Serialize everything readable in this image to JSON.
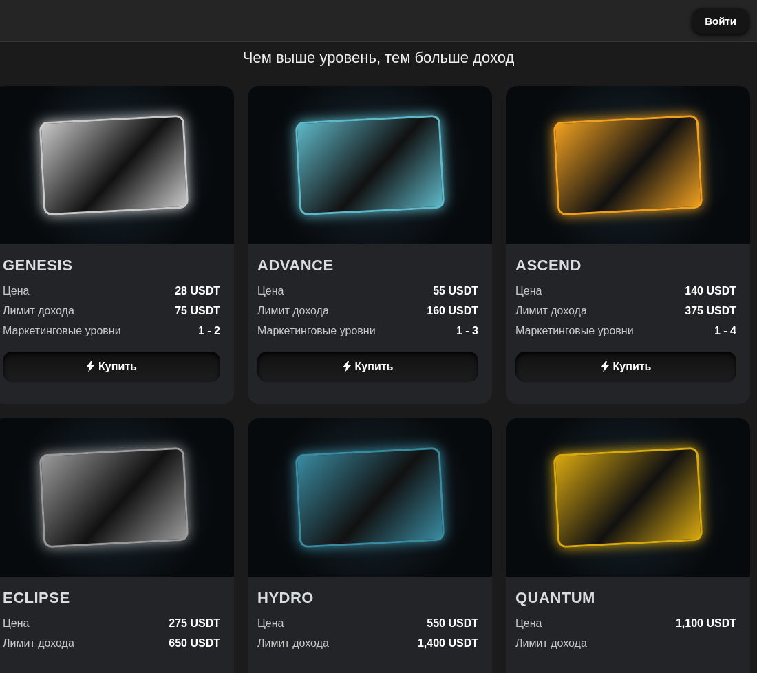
{
  "header": {
    "login_button": "Войти"
  },
  "title": "Чем выше уровень, тем больше доход",
  "plans": [
    {
      "name": "GENESIS",
      "color": "#c8c8c8",
      "rows": [
        {
          "label": "Цена",
          "value": "28 USDT"
        },
        {
          "label": "Лимит дохода",
          "value": "75 USDT"
        },
        {
          "label": "Маркетинговые уровни",
          "value": "1 - 2"
        }
      ],
      "buy_button": "Купить"
    },
    {
      "name": "ADVANCE",
      "color": "#5fb8c8",
      "rows": [
        {
          "label": "Цена",
          "value": "55 USDT"
        },
        {
          "label": "Лимит дохода",
          "value": "160 USDT"
        },
        {
          "label": "Маркетинговые уровни",
          "value": "1 - 3"
        }
      ],
      "buy_button": "Купить"
    },
    {
      "name": "ASCEND",
      "color": "#f0a020",
      "rows": [
        {
          "label": "Цена",
          "value": "140 USDT"
        },
        {
          "label": "Лимит дохода",
          "value": "375 USDT"
        },
        {
          "label": "Маркетинговые уровни",
          "value": "1 - 4"
        }
      ],
      "buy_button": "Купить"
    },
    {
      "name": "ECLIPSE",
      "color": "#9a9a9a",
      "rows": [
        {
          "label": "Цена",
          "value": "275 USDT"
        },
        {
          "label": "Лимит дохода",
          "value": "650 USDT"
        }
      ]
    },
    {
      "name": "HYDRO",
      "color": "#3a8aa0",
      "rows": [
        {
          "label": "Цена",
          "value": "550 USDT"
        },
        {
          "label": "Лимит дохода",
          "value": "1,400 USDT"
        }
      ]
    },
    {
      "name": "QUANTUM",
      "color": "#d8a810",
      "rows": [
        {
          "label": "Цена",
          "value": "1,100 USDT"
        },
        {
          "label": "Лимит дохода"
        }
      ]
    }
  ]
}
